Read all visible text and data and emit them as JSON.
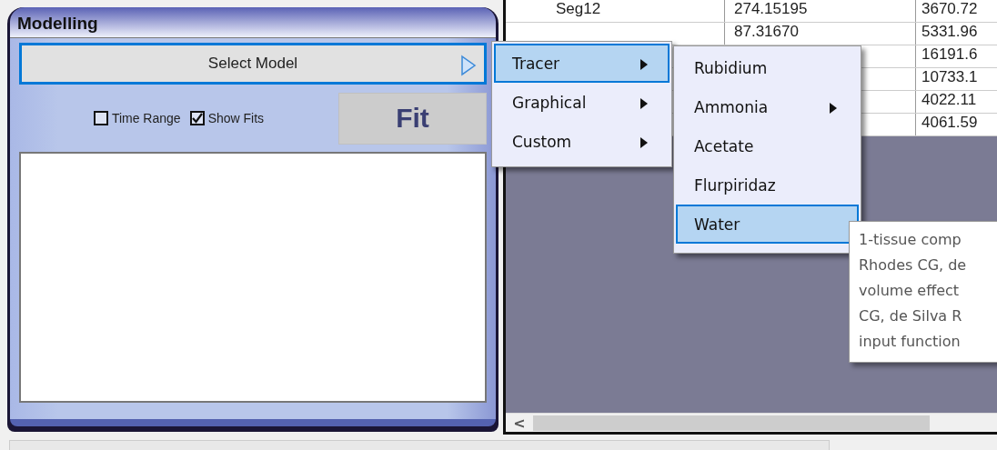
{
  "panel": {
    "title": "Modelling",
    "select_button": "Select Model",
    "checkboxes": [
      {
        "label": "Time Range",
        "checked": false
      },
      {
        "label": "Show Fits",
        "checked": true
      }
    ],
    "fit_button": "Fit"
  },
  "table": {
    "rows": [
      {
        "column_1": "Seg12",
        "column_2": "274.15195",
        "column_3": "3670.72"
      },
      {
        "column_2": "87.31670",
        "column_3": "5331.96"
      },
      {
        "column_3": "16191.6"
      },
      {
        "column_3": "10733.1"
      },
      {
        "column_3": "4022.11"
      },
      {
        "column_3": "4061.59"
      }
    ]
  },
  "menu": {
    "items": [
      {
        "label": "Tracer",
        "selected": true
      },
      {
        "label": "Graphical",
        "selected": false
      },
      {
        "label": "Custom",
        "selected": false
      }
    ]
  },
  "submenu": {
    "items": [
      {
        "label": "Rubidium",
        "selected": false,
        "has_submenu": false
      },
      {
        "label": "Ammonia",
        "selected": false,
        "has_submenu": true
      },
      {
        "label": "Acetate",
        "selected": false,
        "has_submenu": false
      },
      {
        "label": "Flurpiridaz",
        "selected": false,
        "has_submenu": false
      },
      {
        "label": "Water",
        "selected": true,
        "has_submenu": false
      }
    ]
  },
  "tooltip": {
    "lines": [
      "1-tissue comp",
      "Rhodes CG, de",
      "volume effect",
      "CG, de Silva R",
      "input function"
    ]
  },
  "scrollbar": {
    "left_arrow": "<"
  }
}
